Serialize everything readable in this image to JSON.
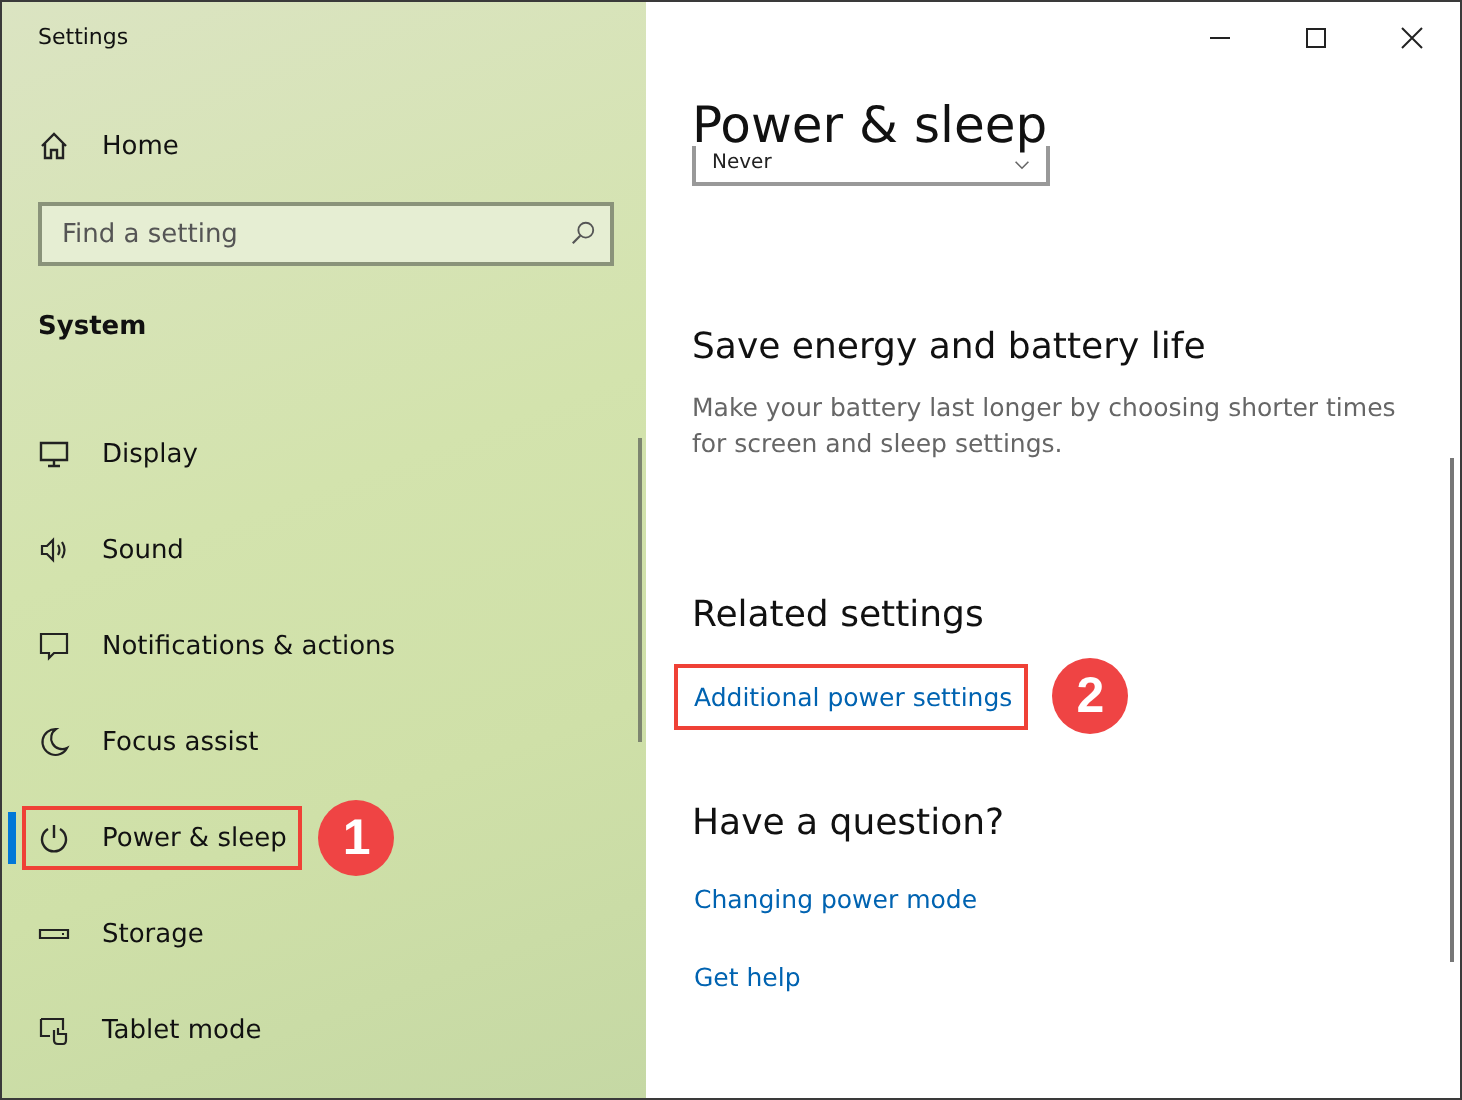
{
  "window": {
    "title": "Settings"
  },
  "sidebar": {
    "home": "Home",
    "search": {
      "placeholder": "Find a setting"
    },
    "section": "System",
    "items": [
      {
        "label": "Display",
        "kind": "display",
        "selected": false
      },
      {
        "label": "Sound",
        "kind": "sound",
        "selected": false
      },
      {
        "label": "Notifications & actions",
        "kind": "notifications",
        "selected": false
      },
      {
        "label": "Focus assist",
        "kind": "focus",
        "selected": false
      },
      {
        "label": "Power & sleep",
        "kind": "power",
        "selected": true,
        "callout": "1"
      },
      {
        "label": "Storage",
        "kind": "storage",
        "selected": false
      },
      {
        "label": "Tablet mode",
        "kind": "tablet",
        "selected": false
      }
    ]
  },
  "content": {
    "title": "Power & sleep",
    "dropdown": {
      "value": "Never"
    },
    "sections": [
      {
        "heading": "Save energy and battery life",
        "text": "Make your battery last longer by choosing shorter times for screen and sleep settings."
      },
      {
        "heading": "Related settings",
        "links": [
          {
            "label": "Additional power settings",
            "callout": "2"
          }
        ]
      },
      {
        "heading": "Have a question?",
        "links": [
          {
            "label": "Changing power mode"
          },
          {
            "label": "Get help"
          }
        ]
      }
    ]
  }
}
